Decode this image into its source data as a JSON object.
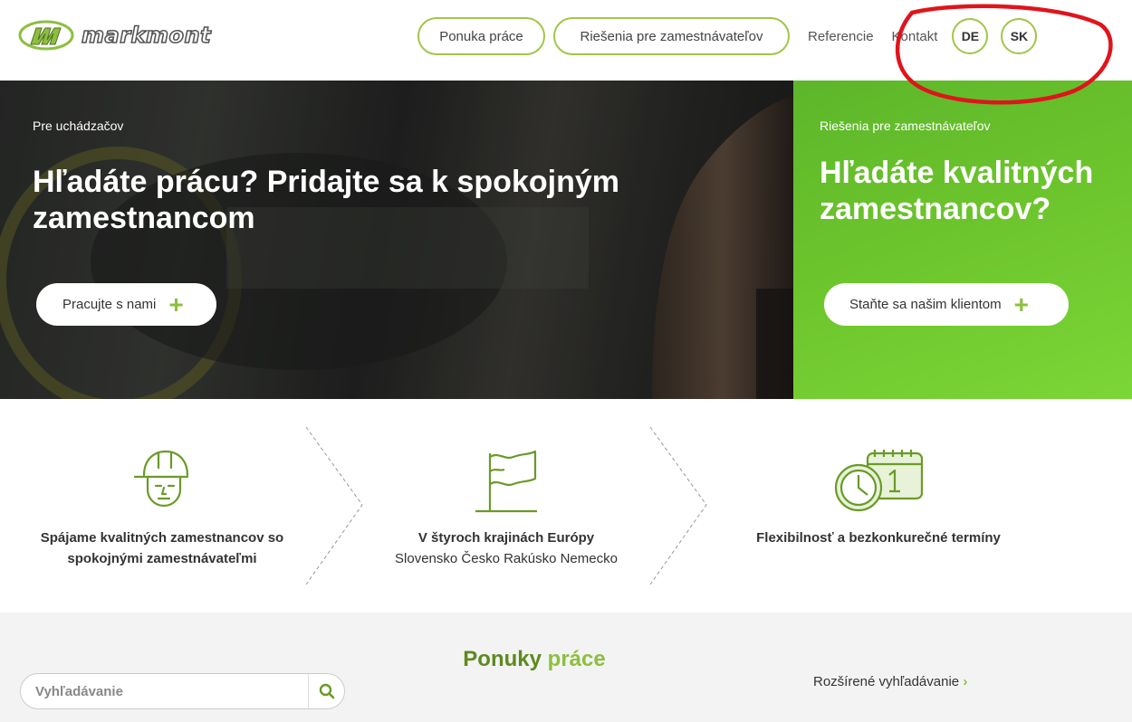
{
  "header": {
    "logo_text": "markmont",
    "nav": {
      "job_offers": "Ponuka práce",
      "employer_solutions": "Riešenia pre zamestnávateľov",
      "references": "Referencie",
      "contact": "Kontakt"
    },
    "languages": [
      "DE",
      "SK"
    ]
  },
  "hero": {
    "left": {
      "eyebrow": "Pre uchádzačov",
      "title_line1": "Hľadáte prácu? Pridajte sa k spokojným",
      "title_line2": "zamestnancom",
      "button": "Pracujte s nami"
    },
    "right": {
      "eyebrow": "Riešenia pre zamestnávateľov",
      "title_line1": "Hľadáte kvalitných",
      "title_line2": "zamestnancov?",
      "button": "Staňte sa našim klientom"
    },
    "plus_symbol": "+"
  },
  "features": [
    {
      "icon": "worker-icon",
      "line1": "Spájame kvalitných zamestnancov so",
      "line2": "spokojnými zamestnávateľmi"
    },
    {
      "icon": "flag-icon",
      "line1": "V štyroch krajinách Európy",
      "line2": "Slovensko Česko Rakúsko Nemecko"
    },
    {
      "icon": "calendar-clock-icon",
      "line1": "Flexibilnosť a bezkonkurečné termíny",
      "line2": ""
    }
  ],
  "offers": {
    "title_word1": "Ponuky",
    "title_word2": "práce",
    "search_placeholder": "Vyhľadávanie",
    "advanced_search": "Rozšírené vyhľadávanie",
    "advanced_arrow": "›"
  },
  "colors": {
    "brand_green": "#8cbf3f",
    "hero_green": "#6cc42c",
    "annotation_red": "#e0141c"
  }
}
